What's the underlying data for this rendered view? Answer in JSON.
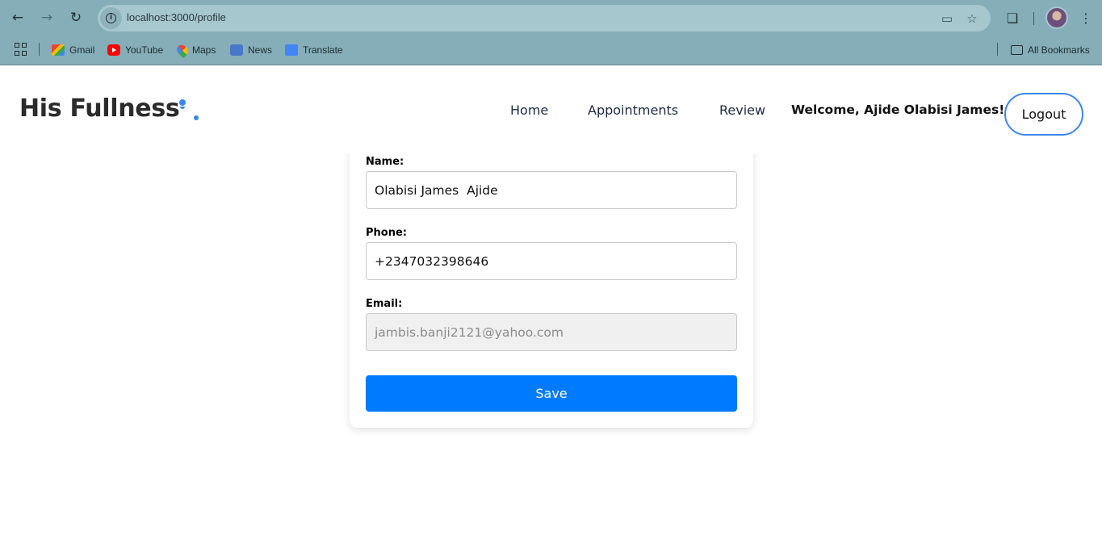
{
  "browser": {
    "url": "localhost:3000/profile",
    "bookmarks": [
      {
        "label": "Gmail",
        "icon": "gmail-icon"
      },
      {
        "label": "YouTube",
        "icon": "youtube-icon"
      },
      {
        "label": "Maps",
        "icon": "maps-icon"
      },
      {
        "label": "News",
        "icon": "news-icon"
      },
      {
        "label": "Translate",
        "icon": "translate-icon"
      }
    ],
    "all_bookmarks_label": "All Bookmarks"
  },
  "header": {
    "brand": "His Fullness",
    "nav": [
      {
        "label": "Home"
      },
      {
        "label": "Appointments"
      },
      {
        "label": "Review"
      }
    ],
    "welcome": "Welcome, Ajide Olabisi James!",
    "logout_label": "Logout"
  },
  "form": {
    "name_label": "Name:",
    "name_value": "Olabisi James  Ajide",
    "phone_label": "Phone:",
    "phone_value": "+2347032398646",
    "email_label": "Email:",
    "email_value": "jambis.banji2121@yahoo.com",
    "save_label": "Save"
  },
  "colors": {
    "accent": "#007bff",
    "brand_dot": "#3a86f0",
    "chrome": "#85aeb9"
  }
}
